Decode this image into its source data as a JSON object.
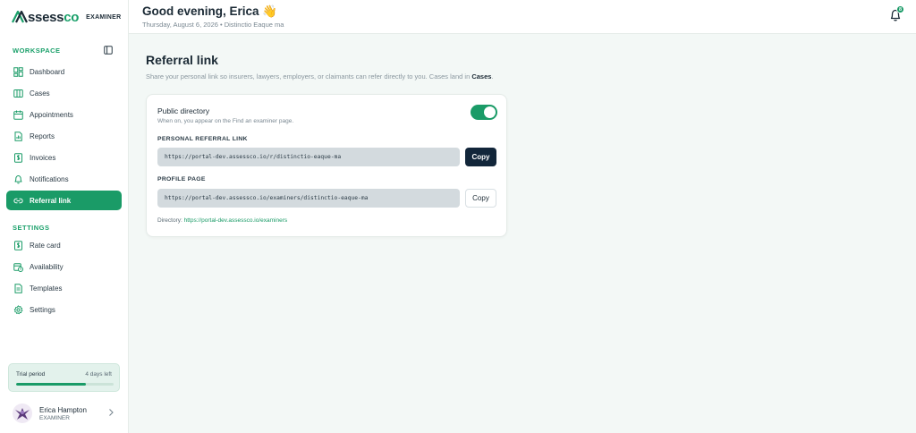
{
  "brand": {
    "name_prefix": "ssess",
    "name_suffix": "co",
    "role": "EXAMINER"
  },
  "sidebar": {
    "workspace_label": "WORKSPACE",
    "settings_label": "SETTINGS",
    "workspace_items": [
      {
        "label": "Dashboard",
        "icon": "dashboard-icon"
      },
      {
        "label": "Cases",
        "icon": "cases-icon"
      },
      {
        "label": "Appointments",
        "icon": "calendar-icon"
      },
      {
        "label": "Reports",
        "icon": "report-icon"
      },
      {
        "label": "Invoices",
        "icon": "invoice-icon"
      },
      {
        "label": "Notifications",
        "icon": "bell-icon"
      },
      {
        "label": "Referral link",
        "icon": "link-icon",
        "active": true
      }
    ],
    "settings_items": [
      {
        "label": "Rate card",
        "icon": "rate-card-icon"
      },
      {
        "label": "Availability",
        "icon": "availability-icon"
      },
      {
        "label": "Templates",
        "icon": "template-icon"
      },
      {
        "label": "Settings",
        "icon": "gear-icon"
      }
    ],
    "trial": {
      "label": "Trial period",
      "days_left": "4 days left",
      "progress": 0.72
    },
    "user": {
      "name": "Erica Hampton",
      "role": "EXAMINER"
    }
  },
  "header": {
    "greeting": "Good evening, Erica 👋",
    "subline": "Thursday, August 6, 2026 • Distinctio Eaque ma",
    "notification_count": "8"
  },
  "main": {
    "title": "Referral link",
    "description_prefix": "Share your personal link so insurers, lawyers, employers, or claimants can refer directly to you. Cases land in ",
    "description_bold": "Cases",
    "description_suffix": ".",
    "public_directory": {
      "title": "Public directory",
      "description": "When on, you appear on the Find an examiner page.",
      "enabled": true
    },
    "referral": {
      "label": "PERSONAL REFERRAL LINK",
      "url": "https://portal-dev.assessco.io/r/distinctio-eaque-ma",
      "copy_label": "Copy"
    },
    "profile": {
      "label": "PROFILE PAGE",
      "url": "https://portal-dev.assessco.io/examiners/distinctio-eaque-ma",
      "copy_label": "Copy"
    },
    "directory": {
      "prefix": "Directory: ",
      "url": "https://portal-dev.assessco.io/examiners"
    }
  },
  "colors": {
    "accent": "#1a9b67",
    "dark": "#12263a",
    "background": "#f3f8f6"
  }
}
